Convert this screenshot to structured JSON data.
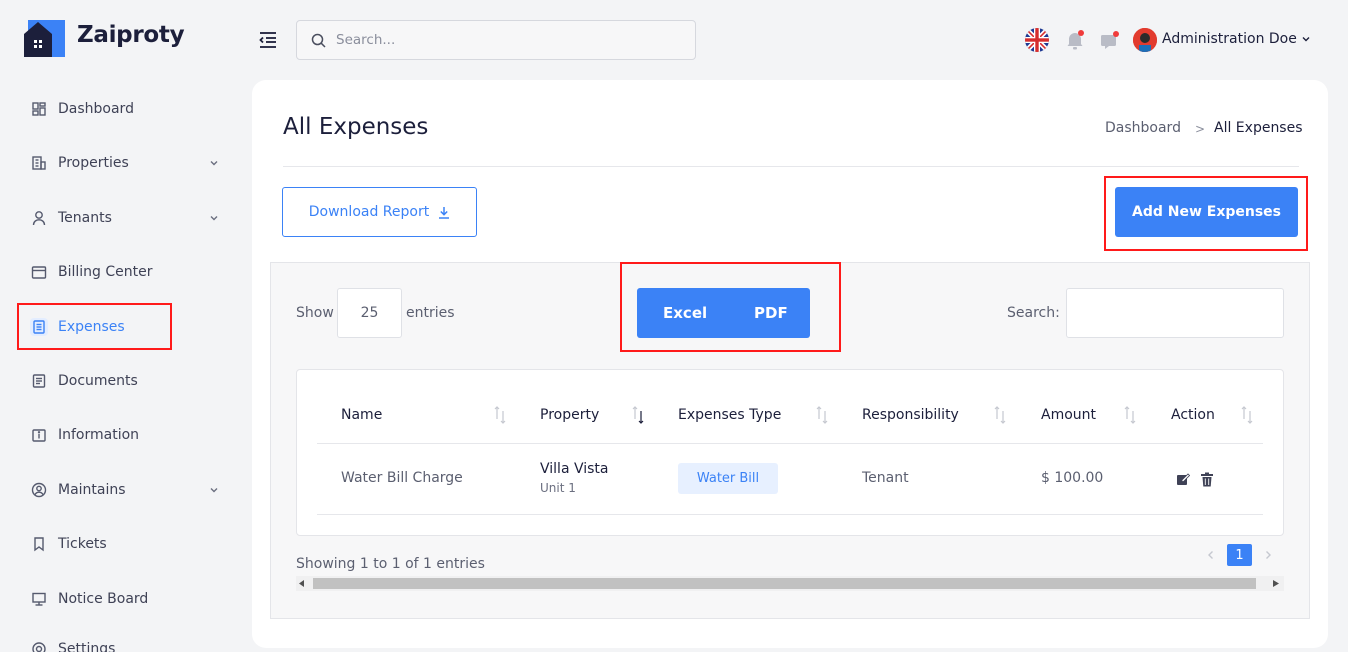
{
  "brand": {
    "name": "Zaiproty"
  },
  "sidebar": {
    "items": [
      {
        "label": "Dashboard"
      },
      {
        "label": "Properties"
      },
      {
        "label": "Tenants"
      },
      {
        "label": "Billing Center"
      },
      {
        "label": "Expenses"
      },
      {
        "label": "Documents"
      },
      {
        "label": "Information"
      },
      {
        "label": "Maintains"
      },
      {
        "label": "Tickets"
      },
      {
        "label": "Notice Board"
      },
      {
        "label": "Settings"
      }
    ]
  },
  "topbar": {
    "search_placeholder": "Search...",
    "user_name": "Administration Doe"
  },
  "page": {
    "title": "All Expenses",
    "breadcrumb": {
      "home": "Dashboard",
      "separator": ">",
      "current": "All Expenses"
    },
    "download_label": "Download Report",
    "add_label": "Add New Expenses"
  },
  "table_controls": {
    "show_label": "Show",
    "entries_value": "25",
    "entries_label": "entries",
    "excel_label": "Excel",
    "pdf_label": "PDF",
    "search_label": "Search:"
  },
  "table": {
    "columns": [
      "Name",
      "Property",
      "Expenses Type",
      "Responsibility",
      "Amount",
      "Action"
    ],
    "rows": [
      {
        "name": "Water Bill Charge",
        "property": "Villa Vista",
        "unit": "Unit 1",
        "type": "Water Bill",
        "responsibility": "Tenant",
        "amount": "$ 100.00"
      }
    ]
  },
  "footer": {
    "showing": "Showing 1 to 1 of 1 entries",
    "page": "1"
  },
  "colors": {
    "accent": "#3b82f6",
    "highlight": "#ff1a1a"
  }
}
